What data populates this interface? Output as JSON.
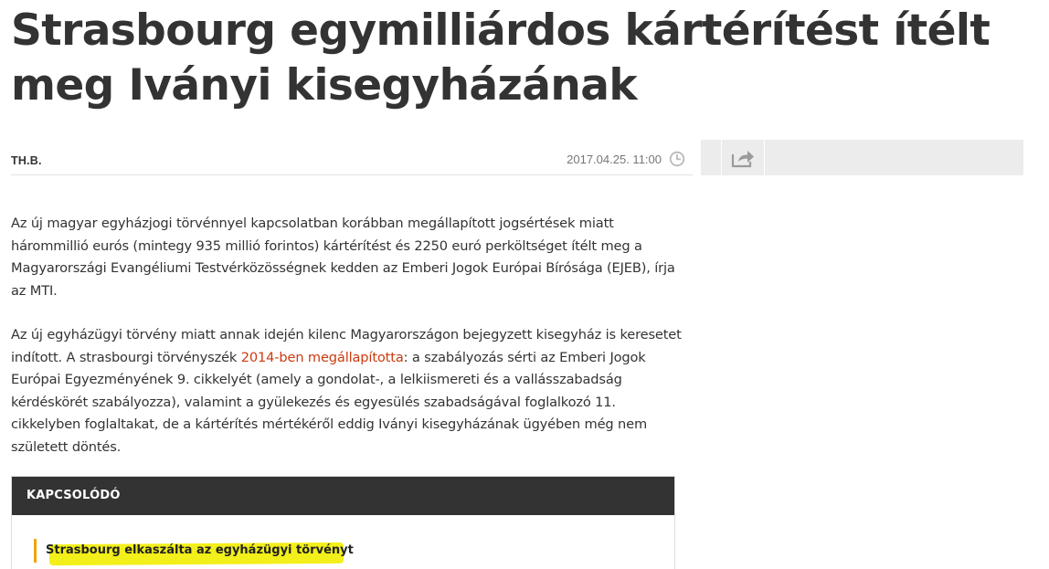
{
  "article": {
    "title": "Strasbourg egymilliárdos kártérítést ítélt meg Iványi kisegyházának",
    "author": "TH.B.",
    "date": "2017.04.25. 11:00",
    "paragraphs": {
      "p1": "Az új magyar egyházjogi törvénnyel kapcsolatban korábban megállapított jogsértések miatt hárommillió eurós (mintegy 935 millió forintos) kártérítést és 2250 euró perköltséget ítélt meg a Magyarországi Evangéliumi Testvérközösségnek kedden az Emberi Jogok Európai Bírósága (EJEB), írja az MTI.",
      "p2_before": "Az új egyházügyi törvény miatt annak idején kilenc Magyarországon bejegyzett kisegyház is keresetet indított. A strasbourgi törvényszék ",
      "p2_link": "2014-ben megállapította",
      "p2_after": ": a szabályozás sérti az Emberi Jogok Európai Egyezményének 9. cikkelyét (amely a gondolat-, a lelkiismereti és a vallásszabadság kérdéskörét szabályozza), valamint a gyülekezés és egyesülés szabadságával foglalkozó 11. cikkelyben foglaltakat, de a kártérítés mértékéről eddig Iványi kisegyházának ügyében még nem született döntés."
    }
  },
  "icons": {
    "clock": "clock-icon",
    "share": "share-icon"
  },
  "related": {
    "header": "KAPCSOLÓDÓ",
    "items": [
      {
        "label": "Strasbourg elkaszálta az egyházügyi törvényt"
      }
    ]
  },
  "colors": {
    "link": "#cc3a0f",
    "accent_bar": "#f0a400",
    "highlight": "#f3ef1a",
    "related_header_bg": "#333333"
  }
}
